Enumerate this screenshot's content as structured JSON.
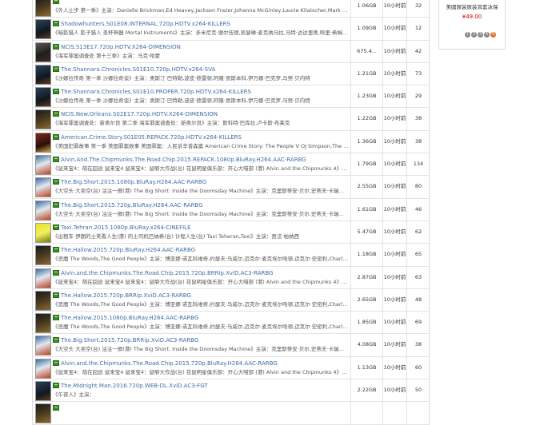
{
  "sidebar_promo": {
    "title": "美國原装原装耳套冰保",
    "price": "¥49.00",
    "pages": [
      "1",
      "2",
      "3",
      "4",
      "5"
    ],
    "active_page": "5"
  },
  "rows": [
    {
      "title": "",
      "desc": "《外人止步 第一季》主演：Danielle Brickman,Ed Heavey,Jackson Frazer,Johanna McGinley,Laurie Kilatscher,Mark Jeffrey Miller...",
      "size": "1.06GB",
      "time": "10小时前",
      "seeds": "32",
      "poster": "c5"
    },
    {
      "title": "Shadowhunters.S01E08.INTERNAL.720p.HDTV.x264-KILLERS",
      "desc": "《暗影猎人 影子猎人 圣杯神器 Mortal Instruments》主演：多米尼克·谢尔伍德,凯瑟琳·麦克纳马拉,马特·达达里奥,哈里·希姆·史密...",
      "size": "1.09GB",
      "time": "10小时前",
      "seeds": "12",
      "poster": "c1"
    },
    {
      "title": "NCIS.S13E17.720p.HDTV.X264-DIMENSION",
      "desc": "《海军罪案调查处 第十三季》主演：马克·哈蒙",
      "size": "675.4...",
      "time": "10小时前",
      "seeds": "42",
      "poster": ""
    },
    {
      "title": "The.Shannara.Chronicles.S01E10.720p.HDTV.x264-SVA",
      "desc": "《沙娜拉传奇 第一季 沙娜拉奇谈》主演：奥斯汀·巴特勒,波皮·德雷顿,阿隆·贾斯本科,伊万娜·巴克罗,马努·贝内特",
      "size": "1.21GB",
      "time": "10小时前",
      "seeds": "73",
      "poster": "c1"
    },
    {
      "title": "The.Shannara.Chronicles.S01E10.PROPER.720p.HDTV.x264-KILLERS",
      "desc": "《沙娜拉传奇 第一季 沙娜拉奇谈》主演：奥斯汀·巴特勒,波皮·德雷顿,阿隆·贾斯本科,伊万娜·巴克罗,马努·贝内特",
      "size": "1.23GB",
      "time": "10小时前",
      "seeds": "29",
      "poster": "c1"
    },
    {
      "title": "NCIS.New.Orleans.S02E17.720p.HDTV.X264-DIMENSION",
      "desc": "《海军罪案调查处：新奥尔良 第二季 海军罪案调查处：新奥尔良》主演：斯科特·巴库拉,卢卡斯·布莱克",
      "size": "1.22GB",
      "time": "10小时前",
      "seeds": "38",
      "poster": "c5"
    },
    {
      "title": "American.Crime.Story.S01E05.REPACK.720p.HDTV.x264-KILLERS",
      "desc": "《美国犯罪故事 第一季 美国罪案故事 美国罪案：人民诉辛普森案 American Crime Story: The People V OJ Simpson,The Run of His...",
      "size": "1.36GB",
      "time": "10小时前",
      "seeds": "38",
      "poster": "c2"
    },
    {
      "title": "Alvin.And.The.Chipmunks.The.Road.Chip.2015.REPACK.1080p.BluRay.H264.AAC-RARBG",
      "desc": "《鼠来宝4：萌在囧途 鼠来宝4 鼠来宝4：鼠噼大作战(台) 花鼠明星俱乐部：开心大喵部 (港) Alvin and the Chipmunks 4》主演：贾斯...",
      "size": "1.79GB",
      "time": "10小时前",
      "seeds": "134",
      "poster": "c3"
    },
    {
      "title": "The.Big.Short.2015.1080p.BluRay.H264.AAC-RARBG",
      "desc": "《大空头 大卖空(台) 沽注一掷(港) The Big Short: Inside the Doomsday Machine》主演：克里斯蒂安·贝尔,史蒂夫·卡瑞尔,瑞恩·高斯...",
      "size": "2.55GB",
      "time": "10小时前",
      "seeds": "80",
      "poster": "c3"
    },
    {
      "title": "The.Big.Short.2015.720p.BluRay.H264.AAC-RARBG",
      "desc": "《大空头 大卖空(台) 沽注一掷(港) The Big Short: Inside the Doomsday Machine》主演：克里斯蒂安·贝尔,史蒂夫·卡瑞尔,瑞恩·高斯...",
      "size": "1.61GB",
      "time": "10小时前",
      "seeds": "46",
      "poster": "c3"
    },
    {
      "title": "Taxi.Tehran.2015.1080p.BluRay.x264-CINEFILE",
      "desc": "《出租车 伊朗的士笑看人生(港) 的士司机巴纳希(台) 计程人生(台) Taxi Teheran,Taxi》主演：贾法·帕纳西",
      "size": "5.47GB",
      "time": "10小时前",
      "seeds": "62",
      "poster": "c4"
    },
    {
      "title": "The.Hallow.2015.720p.BluRay.H264.AAC-RARBG",
      "desc": "《恶魔 The Woods,The Good People》主演：博亚娜·诺瓦科维奇,约瑟夫·马威尔,迈克尔·麦克埃尔哈顿,迈克尔·史密利,Charlotte Williams",
      "size": "1.18GB",
      "time": "10小时前",
      "seeds": "65",
      "poster": "c5"
    },
    {
      "title": "Alvin.and.the.Chipmunks.The.Road.Chip.2015.720p.BRRip.XviD.AC3-RARBG",
      "desc": "《鼠来宝4：萌在囧途 鼠来宝4 鼠来宝4：鼠噼大作战(台) 花鼠明星俱乐部：开心大喵部 (港) Alvin and the Chipmunks 4》主演：贾斯...",
      "size": "2.87GB",
      "time": "10小时前",
      "seeds": "63",
      "poster": "c3"
    },
    {
      "title": "The.Hallow.2015.720p.BRRip.XviD.AC3-RARBG",
      "desc": "《恶魔 The Woods,The Good People》主演：博亚娜·诺瓦科维奇,约瑟夫·马威尔,迈克尔·麦克埃尔哈顿,迈克尔·史密利,Charlotte Williams",
      "size": "2.65GB",
      "time": "10小时前",
      "seeds": "48",
      "poster": "c5"
    },
    {
      "title": "The.Hallow.2015.1080p.BluRay.H264.AAC-RARBG",
      "desc": "《恶魔 The Woods,The Good People》主演：博亚娜·诺瓦科维奇,约瑟夫·马威尔,迈克尔·麦克埃尔哈顿,迈克尔·史密利,Charlotte Williams",
      "size": "1.85GB",
      "time": "10小时前",
      "seeds": "69",
      "poster": "c5"
    },
    {
      "title": "The.Big.Short.2015.720p.BRRip.XviD.AC3-RARBG",
      "desc": "《大空头 大卖空(台) 沽注一掷(港) The Big Short: Inside the Doomsday Machine》主演：克里斯蒂安·贝尔,史蒂夫·卡瑞尔,瑞恩·高斯...",
      "size": "4.08GB",
      "time": "10小时前",
      "seeds": "38",
      "poster": "c3"
    },
    {
      "title": "Alvin.and.the.Chipmunks.The.Road.Chip.2015.720p.BluRay.H264.AAC-RARBG",
      "desc": "《鼠来宝4：萌在囧途 鼠来宝4 鼠来宝4：鼠噼大作战(台) 花鼠明星俱乐部：开心大喵部 (港) Alvin and the Chipmunks 4》主演：贾斯...",
      "size": "1.13GB",
      "time": "10小时前",
      "seeds": "60",
      "poster": "c3"
    },
    {
      "title": "The.Midnight.Man.2016.720p.WEB-DL.XviD.AC3-FGT",
      "desc": "《午夜人》主演：",
      "size": "2.22GB",
      "time": "10小时前",
      "seeds": "50",
      "poster": "c1"
    },
    {
      "title": "",
      "desc": "",
      "size": "",
      "time": "",
      "seeds": "",
      "poster": "c5"
    }
  ]
}
